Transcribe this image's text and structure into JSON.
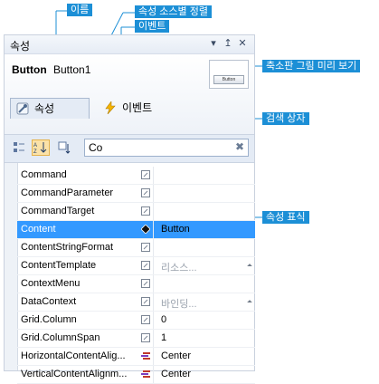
{
  "callouts": {
    "name": "이름",
    "sort_by_source": "속성 소스별 정렬",
    "events": "이벤트",
    "thumbnail_preview": "축소판 그림 미리 보기",
    "search_box": "검색 상자",
    "property_marker": "속성 표식"
  },
  "window": {
    "title": "속성",
    "buttons": [
      "▾",
      "↥",
      "✕"
    ]
  },
  "selection": {
    "type": "Button",
    "name": "Button1",
    "thumbnail_label": "Button"
  },
  "tabs": [
    {
      "label": "속성",
      "icon": "wrench-icon"
    },
    {
      "label": "이벤트",
      "icon": "lightning-icon"
    }
  ],
  "toolbar": {
    "search_value": "Co",
    "clear_icon": "✖"
  },
  "properties": [
    {
      "name": "Command",
      "value": "",
      "marker": "default"
    },
    {
      "name": "CommandParameter",
      "value": "",
      "marker": "default"
    },
    {
      "name": "CommandTarget",
      "value": "",
      "marker": "default"
    },
    {
      "name": "Content",
      "value": "Button",
      "marker": "set",
      "selected": true
    },
    {
      "name": "ContentStringFormat",
      "value": "",
      "marker": "default"
    },
    {
      "name": "ContentTemplate",
      "value": "리소스...",
      "marker": "default",
      "muted": true,
      "dropdown": true
    },
    {
      "name": "ContextMenu",
      "value": "",
      "marker": "default"
    },
    {
      "name": "DataContext",
      "value": "바인딩...",
      "marker": "default",
      "muted": true,
      "dropdown": true
    },
    {
      "name": "Grid.Column",
      "value": "0",
      "marker": "default"
    },
    {
      "name": "Grid.ColumnSpan",
      "value": "1",
      "marker": "default"
    },
    {
      "name": "HorizontalContentAlig...",
      "value": "Center",
      "marker": "style"
    },
    {
      "name": "VerticalContentAlignm...",
      "value": "Center",
      "marker": "style"
    }
  ],
  "colors": {
    "callout_bg": "#1c8fd6",
    "selected_row": "#3399ff"
  }
}
